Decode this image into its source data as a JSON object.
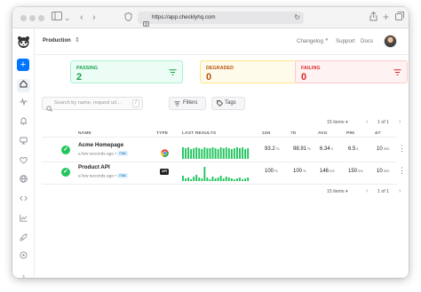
{
  "browser": {
    "url": "https://app.checklyhq.com"
  },
  "topbar": {
    "workspace": "Production",
    "links": [
      "Changelog",
      "Support",
      "Docs"
    ]
  },
  "status_cards": [
    {
      "label": "PASSING",
      "count": "2",
      "color": "#16a34a",
      "bg": "#ecfdf5",
      "border": "#a7f3d0"
    },
    {
      "label": "DEGRADED",
      "count": "0",
      "color": "#b45309",
      "bg": "#fffbeb",
      "border": "#fde68a"
    },
    {
      "label": "FAILING",
      "count": "0",
      "color": "#dc2626",
      "bg": "#fef2f2",
      "border": "#fecaca"
    }
  ],
  "filters": {
    "search_placeholder": "Search by name, request url...",
    "search_shortcut": "/",
    "filters_label": "Filters",
    "tags_label": "Tags"
  },
  "pagination": {
    "items": "15 items",
    "page": "1 of 1"
  },
  "table": {
    "headers": [
      "NAME",
      "TYPE",
      "LAST RESULTS",
      "24H",
      "7D",
      "AVG",
      "P95",
      "ΔT"
    ],
    "rows": [
      {
        "name": "Acme Homepage",
        "subtitle": "a few seconds ago",
        "tag": "mac",
        "type": "browser",
        "h24": "93.2",
        "h24_unit": "%",
        "d7": "98.91",
        "d7_unit": "%",
        "avg": "6.34",
        "avg_unit": "s",
        "p95": "6.5",
        "p95_unit": "s",
        "dt": "10",
        "dt_unit": "min"
      },
      {
        "name": "Product API",
        "subtitle": "a few seconds ago",
        "tag": "mac",
        "type": "api",
        "type_label": "API",
        "h24": "100",
        "h24_unit": "%",
        "d7": "100",
        "d7_unit": "%",
        "avg": "146",
        "avg_unit": "ms",
        "p95": "150",
        "p95_unit": "ms",
        "dt": "10",
        "dt_unit": "min"
      }
    ]
  },
  "colors": {
    "accent": "#0075ff",
    "success": "#22c55e"
  }
}
